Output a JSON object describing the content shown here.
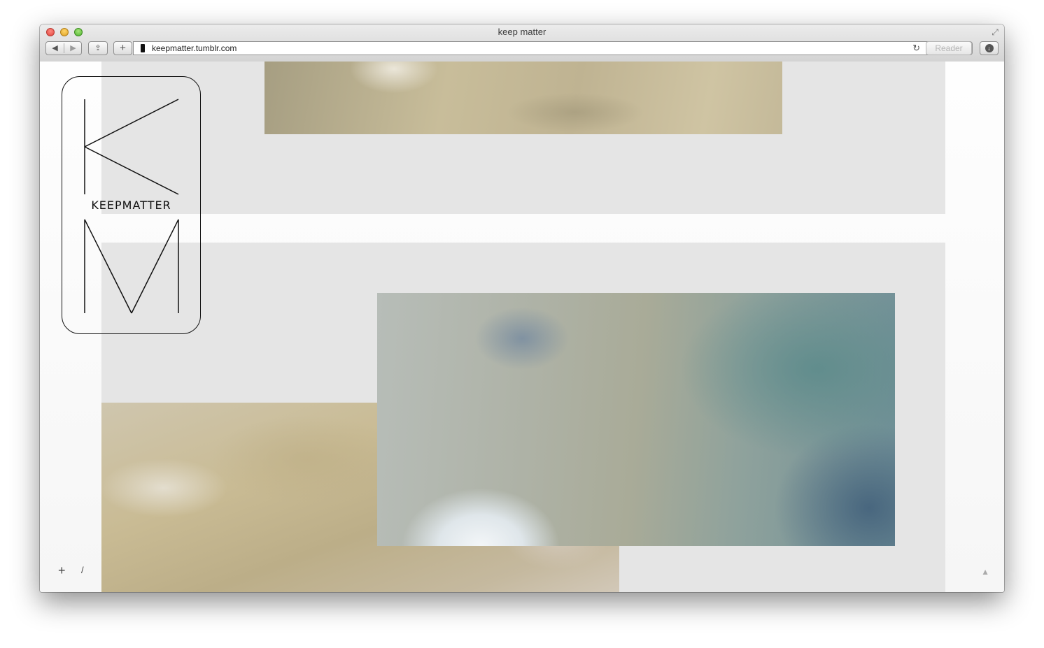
{
  "window": {
    "title": "keep matter"
  },
  "toolbar": {
    "back_icon": "◀",
    "forward_icon": "▶",
    "share_icon": "⇪",
    "new_tab_label": "+",
    "url": "keepmatter.tumblr.com",
    "reload_icon": "↻",
    "reader_label": "Reader",
    "download_icon": "↓",
    "fullscreen_icon": "⤢"
  },
  "page": {
    "logo_text": "KEEPMATTER",
    "footer_plus": "+",
    "footer_slash": "/",
    "scroll_top_icon": "▲"
  },
  "colors": {
    "panel_background": "#e5e5e5",
    "logo_stroke": "#111111"
  }
}
